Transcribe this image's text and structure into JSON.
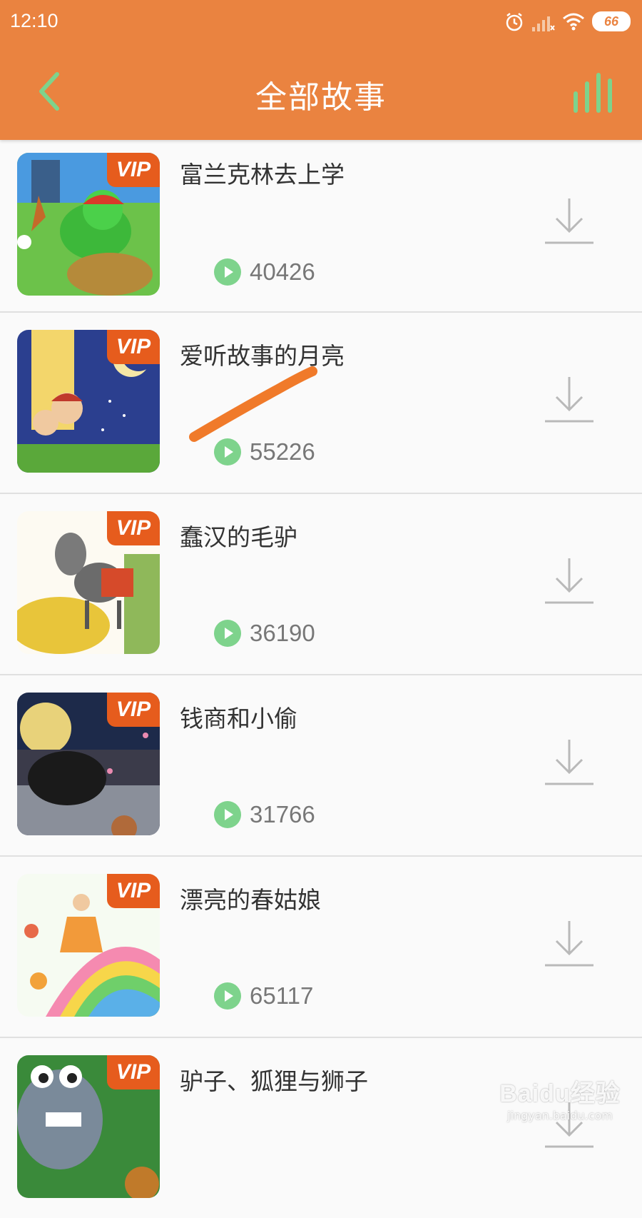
{
  "status_bar": {
    "time": "12:10",
    "battery": "66"
  },
  "header": {
    "title": "全部故事"
  },
  "vip_label": "VIP",
  "colors": {
    "header_bg": "#ea8340",
    "accent_green": "#7ed38c",
    "vip_bg": "#e65c1d",
    "annotation_stroke": "#f07a2a"
  },
  "stories": [
    {
      "title": "富兰克林去上学",
      "plays": "40426"
    },
    {
      "title": "爱听故事的月亮",
      "plays": "55226"
    },
    {
      "title": "蠢汉的毛驴",
      "plays": "36190"
    },
    {
      "title": "钱商和小偷",
      "plays": "31766"
    },
    {
      "title": "漂亮的春姑娘",
      "plays": "65117"
    },
    {
      "title": "驴子、狐狸与狮子",
      "plays": ""
    }
  ],
  "watermark": {
    "brand": "Baidu经验",
    "url": "jingyan.baidu.com"
  }
}
